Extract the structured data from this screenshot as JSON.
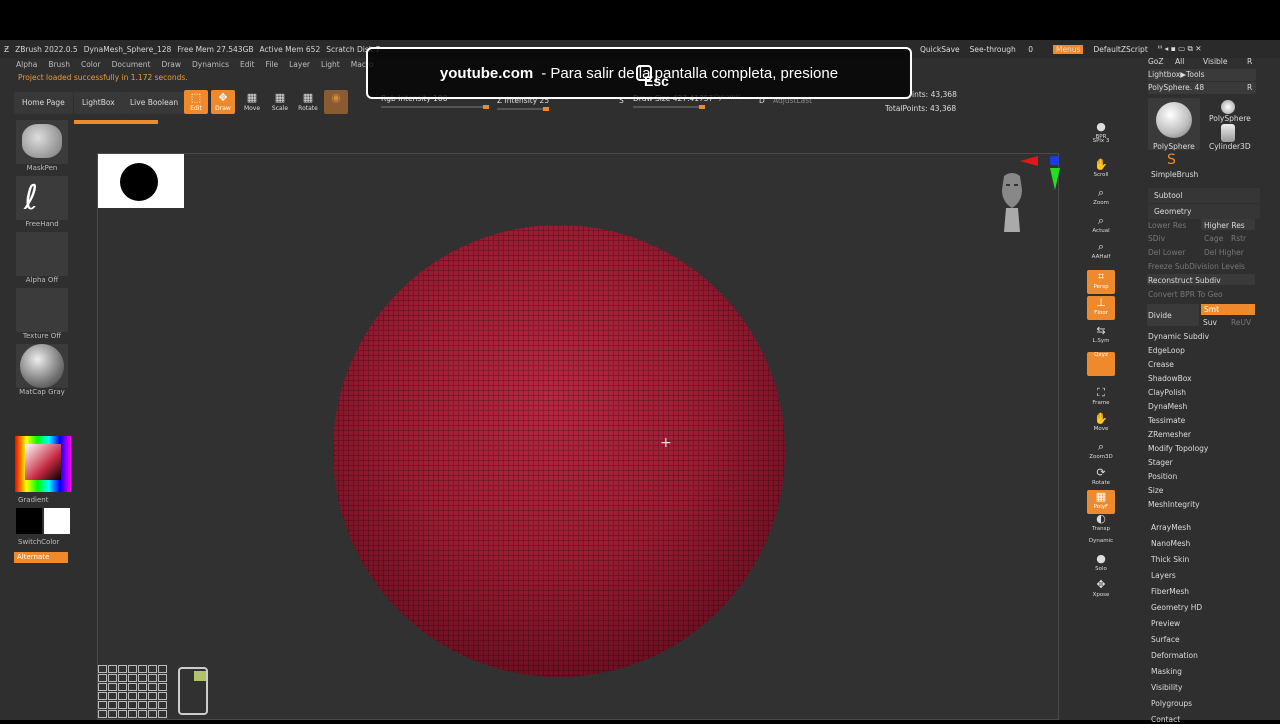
{
  "titlebar": {
    "app": "ZBrush 2022.0.5",
    "file": "DynaMesh_Sphere_128",
    "mem": "Free Mem 27.543GB",
    "active": "Active Mem 652",
    "scratch": "Scratch Disk 7"
  },
  "top_right": {
    "quicksave": "QuickSave",
    "seethrough": "See-through",
    "seethrough_val": "0",
    "menus": "Menus",
    "script": "DefaultZScript"
  },
  "menubar": [
    "Alpha",
    "Brush",
    "Color",
    "Document",
    "Draw",
    "Dynamics",
    "Edit",
    "File",
    "Layer",
    "Light",
    "Macro"
  ],
  "status_message": "Project loaded successfully in 1.172 seconds.",
  "toolbar": {
    "home": "Home Page",
    "lightbox": "LightBox",
    "live_boolean": "Live Boolean",
    "edit": "Edit",
    "draw": "Draw",
    "move": "Move",
    "scale": "Scale",
    "rotate": "Rotate",
    "rgb_label": "Rgb Intensity 100",
    "z_label": "Z Intensity 25",
    "draw_size_label": "Draw Size 427.41757",
    "dynamic": "Dynamic",
    "adjust": "AdjustLast",
    "s_label": "S",
    "d_label": "D",
    "points": "ints: 43,368",
    "total_points": "TotalPoints: 43,368"
  },
  "left_shelf": {
    "brush": "MaskPen",
    "stroke": "FreeHand",
    "alpha": "Alpha Off",
    "texture": "Texture Off",
    "material": "MatCap Gray",
    "gradient": "Gradient",
    "switch": "SwitchColor",
    "alternate": "Alternate"
  },
  "right_shelf": [
    "BPR",
    "SPix 3",
    "Scroll",
    "Zoom",
    "Actual",
    "AAHalf",
    "Persp",
    "Floor",
    "L.Sym",
    "Qxyz",
    "Frame",
    "Move",
    "Zoom3D",
    "Rotate",
    "PolyF",
    "Transp",
    "Dynamic",
    "Solo",
    "Xpose"
  ],
  "right_panel": {
    "goz": "GoZ",
    "all": "All",
    "visible": "Visible",
    "r": "R",
    "lightbox_tools": "Lightbox▶Tools",
    "polysphere_label": "PolySphere. 48",
    "tool1": "PolySphere",
    "tool2": "PolySphere",
    "tool3": "Cylinder3D",
    "tool4": "SimpleBrush",
    "subtool": "Subtool",
    "geometry": "Geometry",
    "lower_res": "Lower Res",
    "higher_res": "Higher Res",
    "sdiv": "SDiv",
    "cage": "Cage",
    "rstr": "Rstr",
    "del_lower": "Del Lower",
    "del_higher": "Del Higher",
    "freeze": "Freeze SubDivision Levels",
    "reconstruct": "Reconstruct Subdiv",
    "convert": "Convert BPR To Geo",
    "divide": "Divide",
    "smt": "Smt",
    "suv": "Suv",
    "reuv": "ReUV",
    "geo_items": [
      "Dynamic Subdiv",
      "EdgeLoop",
      "Crease",
      "ShadowBox",
      "ClayPolish",
      "DynaMesh",
      "Tessimate",
      "ZRemesher",
      "Modify Topology",
      "Stager",
      "Position",
      "Size",
      "MeshIntegrity"
    ],
    "other_items": [
      "ArrayMesh",
      "NanoMesh",
      "Thick Skin",
      "Layers",
      "FiberMesh",
      "Geometry HD",
      "Preview",
      "Surface",
      "Deformation",
      "Masking",
      "Visibility",
      "Polygroups",
      "Contact"
    ]
  },
  "overlay": {
    "host": "youtube.com",
    "message": "-  Para salir de la pantalla completa, presione",
    "key": "Esc"
  }
}
